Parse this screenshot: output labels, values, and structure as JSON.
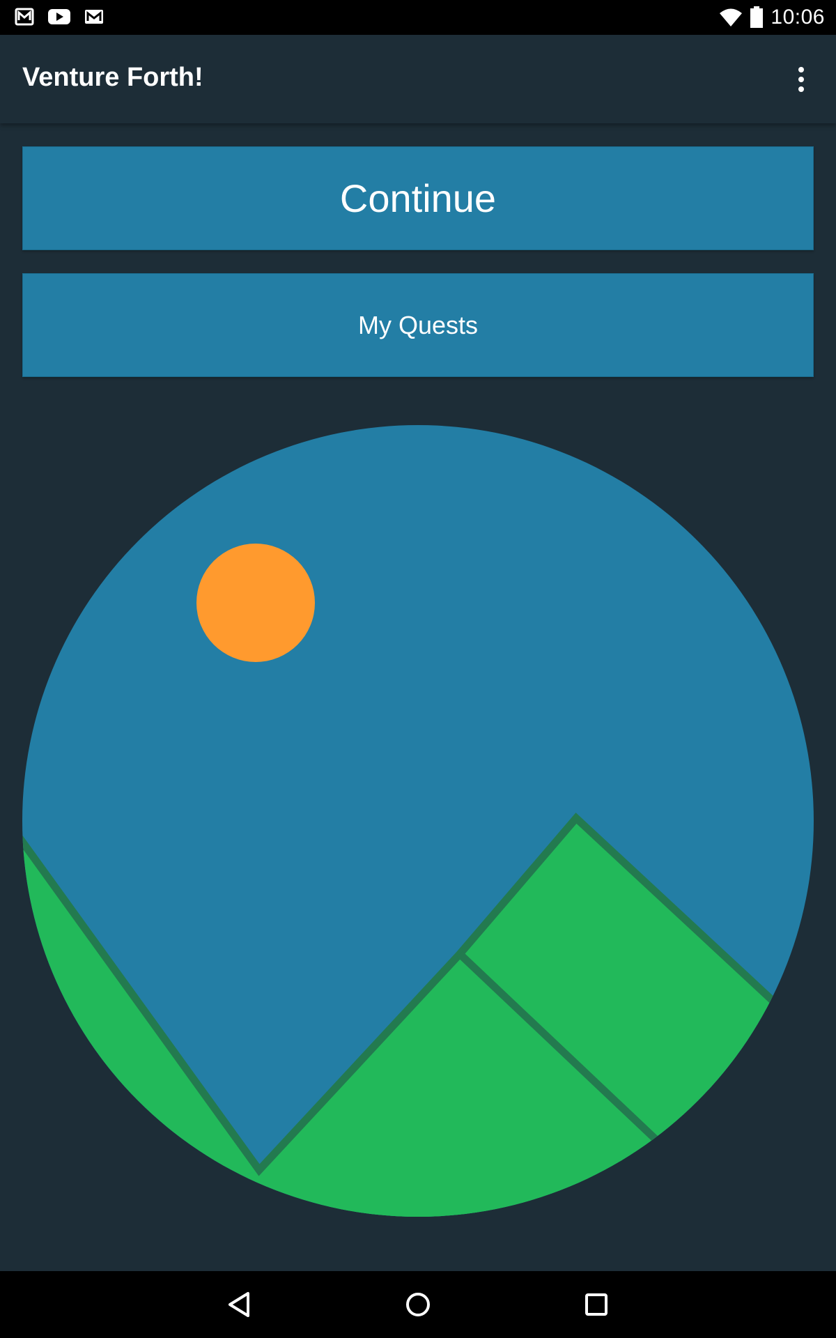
{
  "status_bar": {
    "time": "10:06",
    "icons": [
      "gmail-inbox-icon",
      "youtube-icon",
      "gmail-icon",
      "wifi-icon",
      "battery-icon"
    ]
  },
  "app_bar": {
    "title": "Venture Forth!",
    "menu_icon": "more-vert-icon"
  },
  "buttons": {
    "continue_label": "Continue",
    "quests_label": "My Quests"
  },
  "illustration": {
    "sky_color": "#237ea5",
    "sun_color": "#ff9a2e",
    "mountain_color": "#22b95a",
    "ridge_color": "#237a4f"
  },
  "colors": {
    "background": "#1d2d37",
    "button": "#237ea5",
    "status_bar": "#000000"
  },
  "nav_bar": {
    "icons": [
      "back-icon",
      "home-icon",
      "recents-icon"
    ]
  }
}
